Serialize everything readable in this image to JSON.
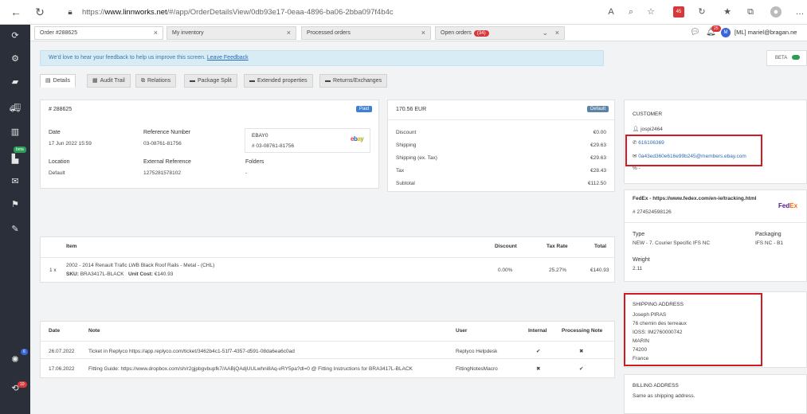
{
  "browser": {
    "url_prefix": "https://",
    "url_host": "www.linnworks.net",
    "url_path": "/#/app/OrderDetailsView/0db93e17-0eaa-4896-ba06-2bba097f4b4c",
    "ext_badge": "45"
  },
  "app_tabs": [
    {
      "label": "Order #288625"
    },
    {
      "label": "My inventory"
    },
    {
      "label": "Processed orders"
    },
    {
      "label": "Open orders",
      "badge": "(34)"
    }
  ],
  "user": {
    "initial": "M",
    "name": "[ML] mariel@bragan.ne",
    "notif_badge": "25"
  },
  "nav": {
    "beta_label": "beta",
    "bulb_badge": "6",
    "sync_badge": "10"
  },
  "feedback": {
    "text": "We'd love to hear your feedback to help us improve this screen.",
    "link": "Leave Feedback"
  },
  "beta_toggle": {
    "label": "BETA"
  },
  "content_tabs": [
    {
      "label": "Details",
      "icon": "details-icon"
    },
    {
      "label": "Audit Trail",
      "icon": "audit-icon"
    },
    {
      "label": "Relations",
      "icon": "relations-icon"
    },
    {
      "label": "Package Split",
      "icon": "package-icon"
    },
    {
      "label": "Extended properties",
      "icon": "properties-icon"
    },
    {
      "label": "Returns/Exchanges",
      "icon": "returns-icon"
    }
  ],
  "order": {
    "number": "# 288625",
    "status": "Paid",
    "date_label": "Date",
    "date": "17 Jun 2022 15:59",
    "ref_label": "Reference Number",
    "ref": "03-08761-81756",
    "location_label": "Location",
    "location": "Default",
    "ext_ref_label": "External Reference",
    "ext_ref": "1275281578102",
    "folders_label": "Folders",
    "folders": "-",
    "channel_name": "EBAY0",
    "channel_ref": "# 03-08761-81756",
    "channel_logo": "ebay"
  },
  "totals": {
    "total": "170.56 EUR",
    "default_label": "Default",
    "rows": [
      {
        "label": "Discount",
        "value": "€0.00"
      },
      {
        "label": "Shipping",
        "value": "€29.63"
      },
      {
        "label": "Shipping (ex. Tax)",
        "value": "€29.63"
      },
      {
        "label": "Tax",
        "value": "€28.43"
      },
      {
        "label": "Subtotal",
        "value": "€112.50"
      }
    ]
  },
  "items": {
    "headers": {
      "item": "Item",
      "discount": "Discount",
      "tax": "Tax Rate",
      "total": "Total"
    },
    "rows": [
      {
        "qty": "1 x",
        "title": "2002 - 2014 Renault Trafic LWB Black Roof Rails - Metal - (CHL)",
        "sku_label": "SKU:",
        "sku": "BRA3417L-BLACK",
        "cost_label": "Unit Cost:",
        "cost": "€140.93",
        "discount": "0.00%",
        "tax": "25.27%",
        "total": "€140.93"
      }
    ]
  },
  "notes": {
    "headers": {
      "date": "Date",
      "note": "Note",
      "user": "User",
      "internal": "Internal",
      "processing": "Processing Note"
    },
    "rows": [
      {
        "date": "26.07.2022",
        "note": "Ticket in Replyco https://app.replyco.com/ticket/3462b4c1-51f7-4357-d591-08da6ea6c0ad",
        "user": "Replyco Helpdesk",
        "internal": "✔",
        "processing": "✖"
      },
      {
        "date": "17.06.2022",
        "note": "Fitting Guide: https://www.dropbox.com/sh/r2gjpbgvbupfk7/AABjQAdjUULwhni8Aq-vRY5pa?dl=0 @ Fitting Instructions for BRA3417L-BLACK",
        "user": "FittingNotesMacro",
        "internal": "✖",
        "processing": "✔"
      }
    ]
  },
  "customer": {
    "heading": "CUSTOMER",
    "username": "jospi2464",
    "phone": "616106369",
    "email": "0a43ed360e616e99b245@members.ebay.com",
    "other": "-"
  },
  "shipping": {
    "carrier": "FedEx - https://www.fedex.com/en-ie/tracking.html",
    "tracking": "# 274524598126",
    "type_label": "Type",
    "type": "NEW - 7. Courier Specific IFS NC",
    "packaging_label": "Packaging",
    "packaging": "IFS NC - B1",
    "weight_label": "Weight",
    "weight": "2.11"
  },
  "shipping_address": {
    "heading": "SHIPPING ADDRESS",
    "lines": [
      "Joseph PIRAS",
      "76 chemin des terreaux",
      "IOSS: IM2760000742",
      "MARIN",
      "74200",
      "France"
    ]
  },
  "billing": {
    "heading": "BILLING ADDRESS",
    "text": "Same as shipping address."
  },
  "colors": {
    "accent": "#3f7fd6",
    "nav": "#2a2f3a",
    "highlight": "#d31a23"
  }
}
